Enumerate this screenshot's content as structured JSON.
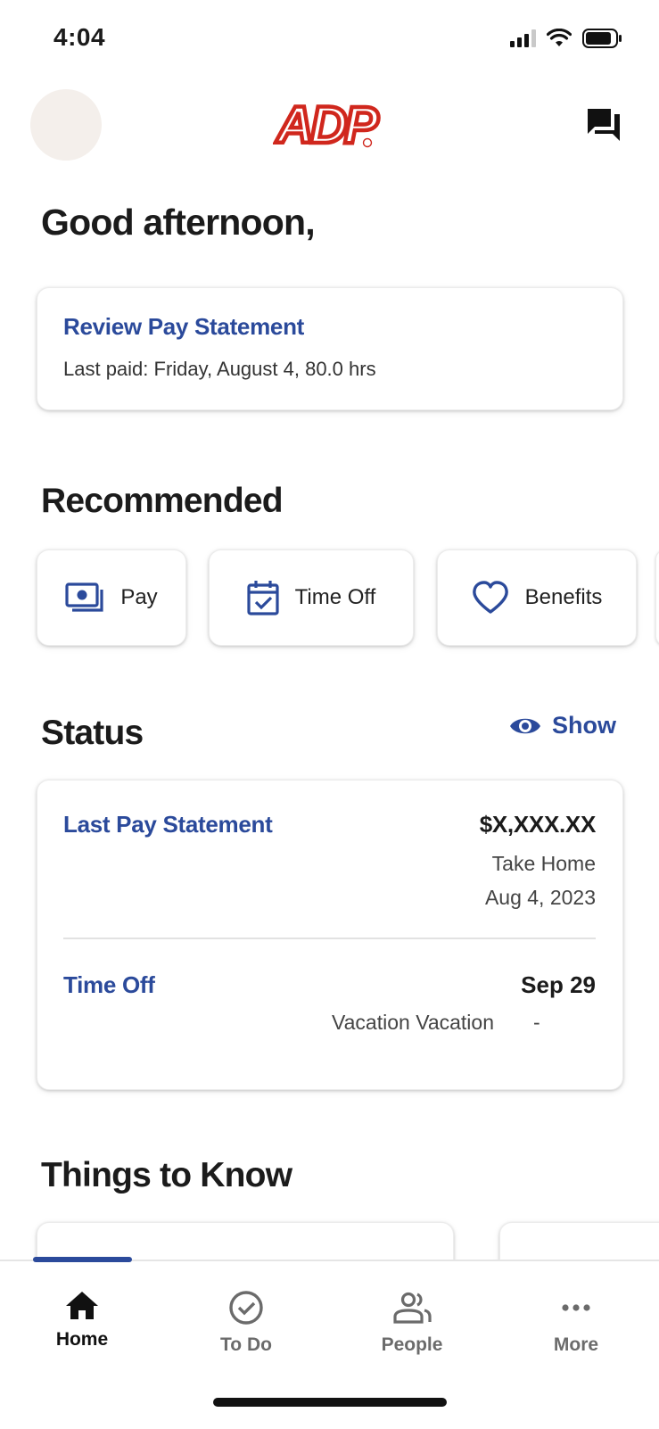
{
  "status_bar": {
    "time": "4:04"
  },
  "header": {
    "logo_text": "ADP"
  },
  "greeting": "Good afternoon,",
  "review_card": {
    "title": "Review Pay Statement",
    "subtitle": "Last paid: Friday, August 4, 80.0 hrs"
  },
  "recommended": {
    "title": "Recommended",
    "items": [
      {
        "label": "Pay",
        "icon": "money-icon"
      },
      {
        "label": "Time Off",
        "icon": "calendar-check-icon"
      },
      {
        "label": "Benefits",
        "icon": "heart-icon"
      }
    ]
  },
  "status": {
    "title": "Status",
    "show_label": "Show",
    "pay": {
      "title": "Last Pay Statement",
      "amount": "$X,XXX.XX",
      "amount_label": "Take Home",
      "date": "Aug 4, 2023"
    },
    "time_off": {
      "title": "Time Off",
      "date": "Sep 29",
      "type": "Vacation Vacation",
      "dash": "-"
    }
  },
  "things_to_know": {
    "title": "Things to Know"
  },
  "bottom_nav": {
    "items": [
      {
        "label": "Home",
        "icon": "home-icon",
        "active": true
      },
      {
        "label": "To Do",
        "icon": "check-circle-icon",
        "active": false
      },
      {
        "label": "People",
        "icon": "people-icon",
        "active": false
      },
      {
        "label": "More",
        "icon": "more-dots-icon",
        "active": false
      }
    ]
  },
  "colors": {
    "accent": "#2b4a9b",
    "brand": "#d0271d",
    "text": "#1b1b1b"
  }
}
